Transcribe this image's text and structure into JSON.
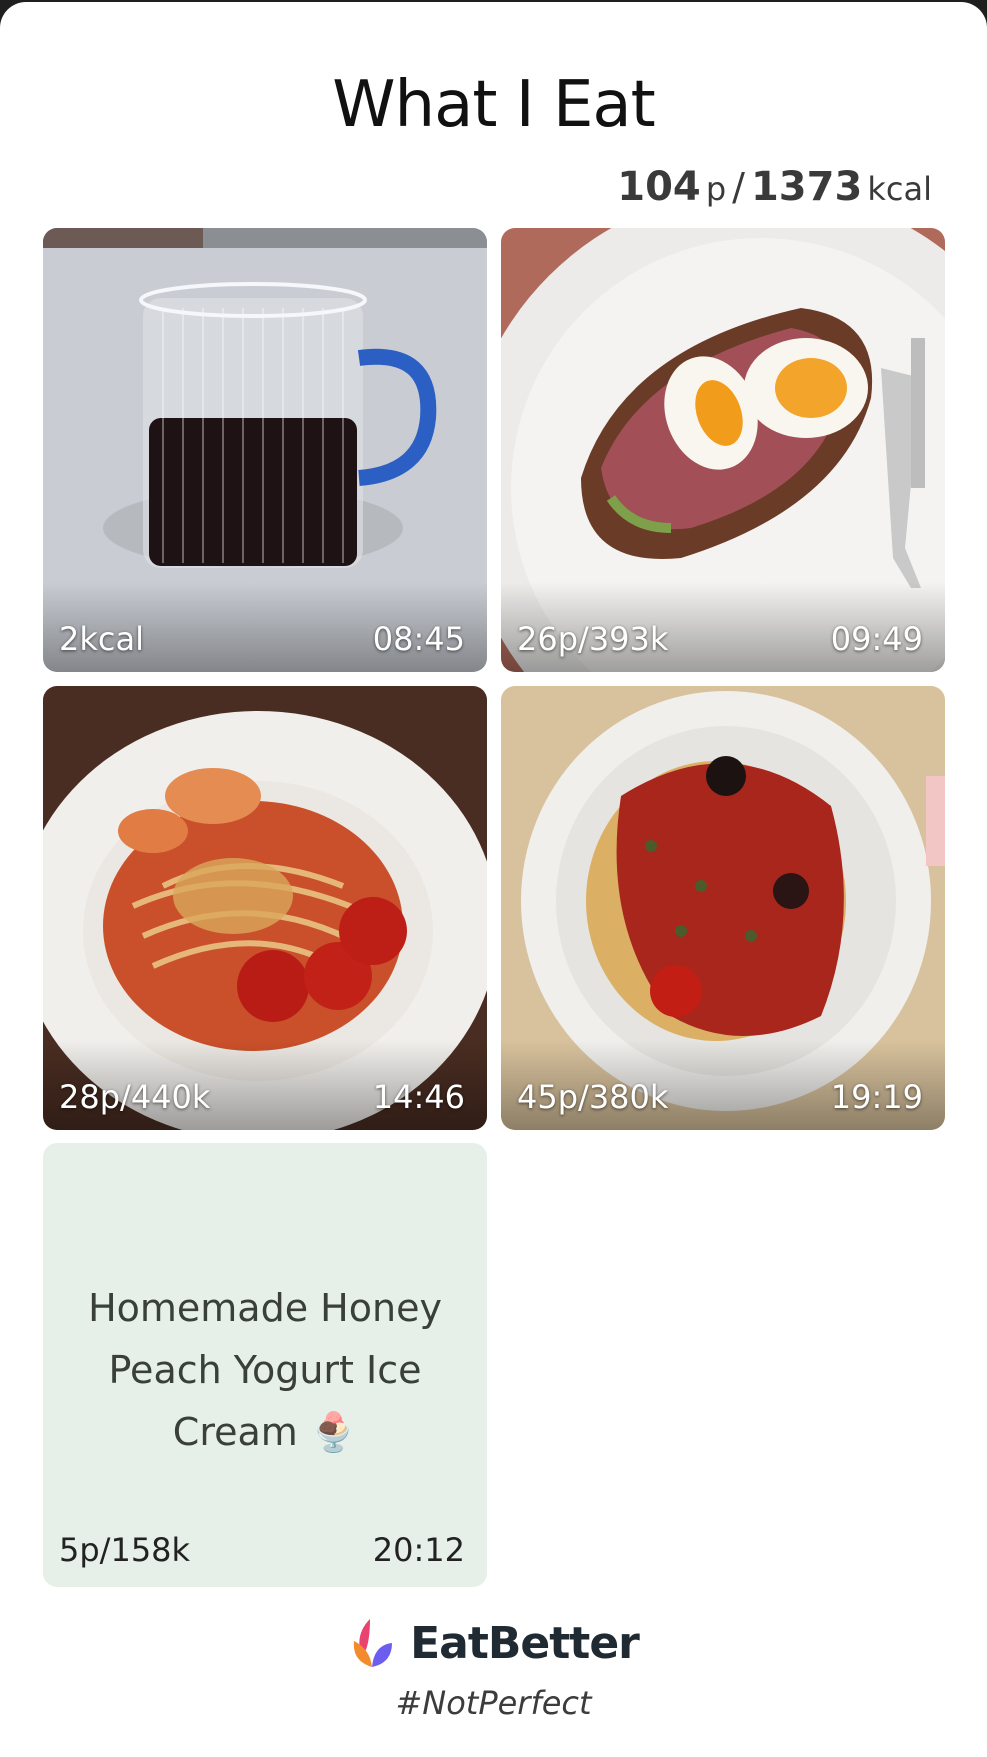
{
  "header": {
    "title": "What I Eat",
    "totals": {
      "protein": "104",
      "protein_unit": "p",
      "separator": "/",
      "kcal": "1373",
      "kcal_unit": "kcal"
    }
  },
  "meals": [
    {
      "nutrition": "2kcal",
      "time": "08:45",
      "icon": "coffee-mug-photo"
    },
    {
      "nutrition": "26p/393k",
      "time": "09:49",
      "icon": "egg-toast-photo"
    },
    {
      "nutrition": "28p/440k",
      "time": "14:46",
      "icon": "shrimp-pasta-photo"
    },
    {
      "nutrition": "45p/380k",
      "time": "19:19",
      "icon": "fish-tomato-photo"
    },
    {
      "nutrition": "5p/158k",
      "time": "20:12",
      "recipe": "Homemade Honey Peach Yogurt Ice Cream 🍨"
    }
  ],
  "footer": {
    "brand": "EatBetter",
    "tagline": "#NotPerfect",
    "logo_icon": "eatbetter-leaf-logo"
  },
  "colors": {
    "recipe_bg": "#e7f0e8",
    "text_dark": "#111111"
  }
}
